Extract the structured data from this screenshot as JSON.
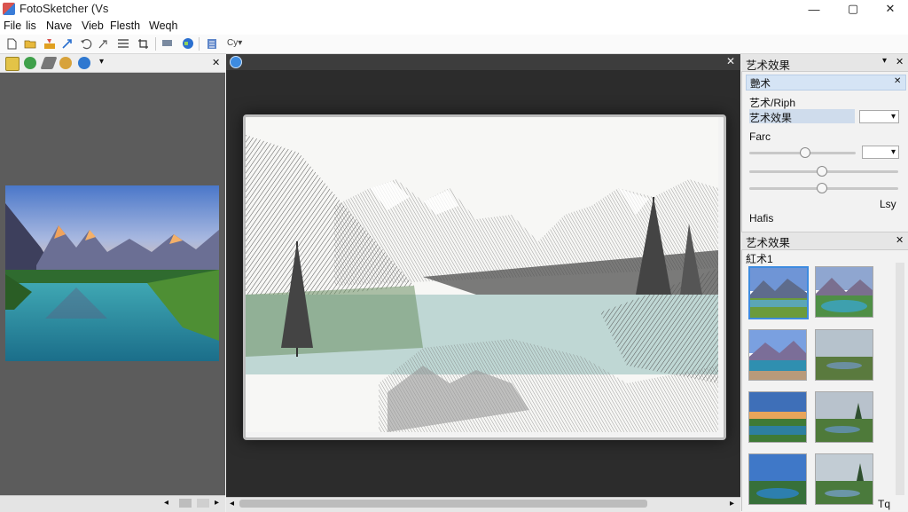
{
  "window": {
    "title": "FotoSketcher (Vs",
    "minimize_glyph": "—",
    "maximize_glyph": "▢",
    "close_glyph": "✕"
  },
  "menu": [
    "File",
    "lis",
    "Nave",
    "Vieb",
    "Flesth",
    "Weqh"
  ],
  "toolbar": {
    "zoom_label": "Cy▾"
  },
  "left_pane": {
    "dropdown_glyph": "▾",
    "close_glyph": "✕",
    "status_prev": "◂",
    "status_next": "▸"
  },
  "center": {
    "close_glyph": "✕",
    "scroll_left": "◂",
    "scroll_right": "▸"
  },
  "right_panel": {
    "title": "艺术效果",
    "pin_glyph": "▾",
    "close_glyph": "✕",
    "tab_label": "艷术",
    "tab_close": "✕",
    "style_heading": "艺术/Riph",
    "style_value": "艺术效果",
    "style_combo_value": "▾",
    "param_label": "Farc",
    "param_combo_value": "▾",
    "sliders": [
      0.53,
      0.57,
      0.57
    ],
    "side_label": "Lsy",
    "footer_label": "Hafis"
  },
  "gallery_panel": {
    "title": "艺术效果",
    "close_glyph": "✕",
    "subheading": "紅术1",
    "footer_label": "Tq"
  },
  "colors": {
    "accent": "#3d8be0",
    "dark_bg": "#2c2c2c",
    "left_bg": "#5c5c5c"
  }
}
